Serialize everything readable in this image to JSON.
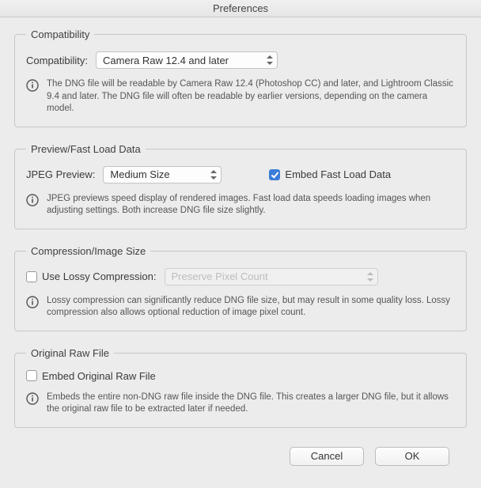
{
  "title": "Preferences",
  "groups": {
    "compat": {
      "legend": "Compatibility",
      "label": "Compatibility:",
      "value": "Camera Raw 12.4 and later",
      "info": "The DNG file will be readable by Camera Raw 12.4 (Photoshop CC) and later, and Lightroom Classic 9.4 and later. The DNG file will often be readable by earlier versions, depending on the camera model."
    },
    "preview": {
      "legend": "Preview/Fast Load Data",
      "label": "JPEG Preview:",
      "value": "Medium Size",
      "embed_fast_label": "Embed Fast Load Data",
      "embed_fast_checked": true,
      "info": "JPEG previews speed display of rendered images.  Fast load data speeds loading images when adjusting settings.  Both increase DNG file size slightly."
    },
    "compression": {
      "legend": "Compression/Image Size",
      "lossy_label": "Use Lossy Compression:",
      "lossy_checked": false,
      "lossy_option": "Preserve Pixel Count",
      "info": "Lossy compression can significantly reduce DNG file size, but may result in some quality loss. Lossy compression also allows optional reduction of image pixel count."
    },
    "original": {
      "legend": "Original Raw File",
      "embed_label": "Embed Original Raw File",
      "embed_checked": false,
      "info": "Embeds the entire non-DNG raw file inside the DNG file.  This creates a larger DNG file, but it allows the original raw file to be extracted later if needed."
    }
  },
  "buttons": {
    "cancel": "Cancel",
    "ok": "OK"
  }
}
